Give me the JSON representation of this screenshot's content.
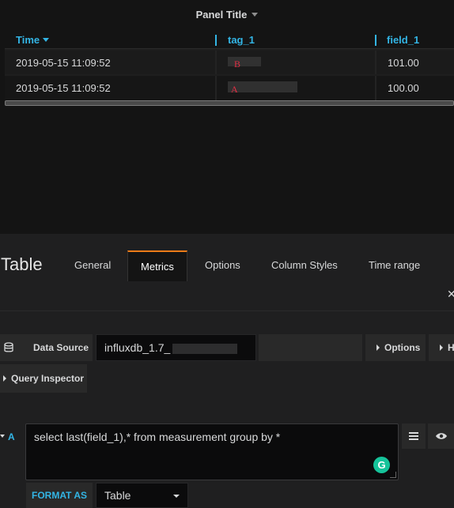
{
  "panel": {
    "title": "Panel Title",
    "columns": [
      "Time",
      "tag_1",
      "field_1"
    ],
    "rows": [
      {
        "time": "2019-05-15 11:09:52",
        "tag": "B",
        "field": "101.00"
      },
      {
        "time": "2019-05-15 11:09:52",
        "tag": "A",
        "field": "100.00"
      }
    ]
  },
  "editor": {
    "title": "Table",
    "tabs": [
      "General",
      "Metrics",
      "Options",
      "Column Styles",
      "Time range"
    ],
    "active_tab": "Metrics",
    "datasource_label": "Data Source",
    "datasource_value": "influxdb_1.7_",
    "options_button": "Options",
    "help_button_partial": "H",
    "query_inspector": "Query Inspector",
    "query": {
      "ref": "A",
      "text": "select last(field_1),* from measurement group by *"
    },
    "format_label": "FORMAT AS",
    "format_value": "Table"
  },
  "colors": {
    "accent_blue": "#33b5e5",
    "accent_orange": "#eb7b18",
    "tag_red": "#e02f44",
    "grammarly_green": "#15c39a"
  }
}
